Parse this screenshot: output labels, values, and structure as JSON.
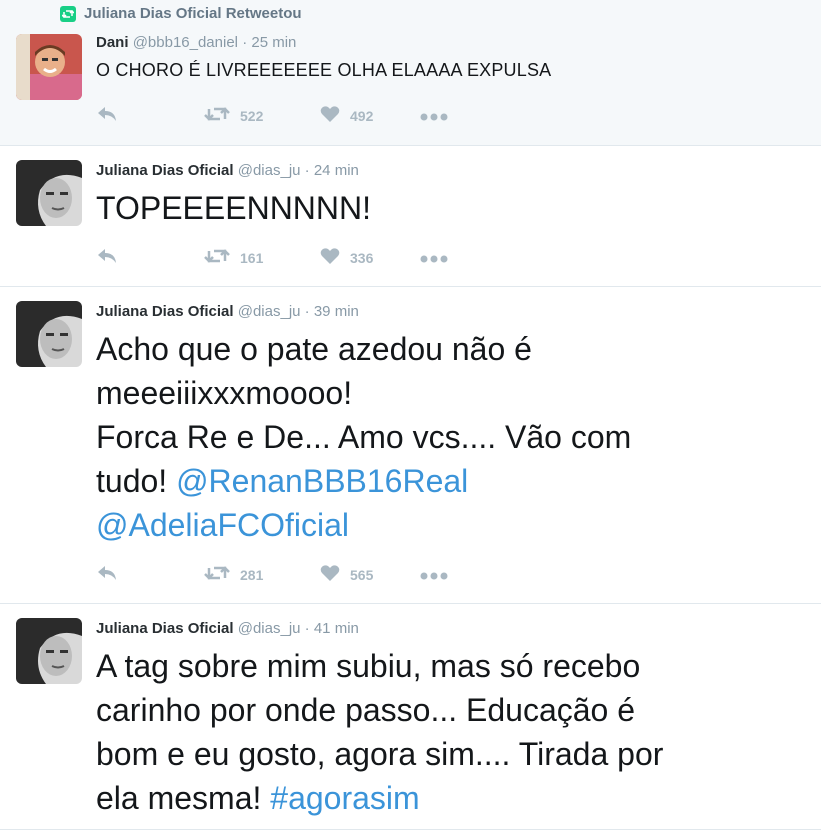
{
  "tweets": [
    {
      "retweet_context": "Juliana Dias Oficial Retweetou",
      "name": "Dani",
      "handle": "@bbb16_daniel",
      "time": "25 min",
      "text": "O CHORO É LIVREEEEEEE OLHA ELAAAA EXPULSA",
      "retweets": "522",
      "likes": "492"
    },
    {
      "name": "Juliana Dias Oficial",
      "handle": "@dias_ju",
      "time": "24 min",
      "text": "TOPEEEENNNNN!",
      "retweets": "161",
      "likes": "336"
    },
    {
      "name": "Juliana Dias Oficial",
      "handle": "@dias_ju",
      "time": "39 min",
      "text_line1": "Acho que o pate azedou não é",
      "text_line2": "meeeiiixxxmoooo!",
      "text_line3": "Forca Re e De... Amo vcs.... Vão com",
      "text_line4_prefix": "tudo! ",
      "mention1": "@RenanBBB16Real",
      "mention2": "@AdeliaFCOficial",
      "retweets": "281",
      "likes": "565"
    },
    {
      "name": "Juliana Dias Oficial",
      "handle": "@dias_ju",
      "time": "41 min",
      "text_line1": "A tag sobre mim subiu, mas só recebo",
      "text_line2": "carinho por onde passo... Educação é",
      "text_line3": "bom e eu gosto, agora sim.... Tirada por",
      "text_line4_prefix": "ela mesma! ",
      "hashtag": "#agorasim"
    }
  ],
  "separator": "·",
  "icons": {
    "reply": "reply-icon",
    "retweet": "retweet-icon",
    "like": "heart-icon",
    "more": "more-icon"
  },
  "colors": {
    "link": "#3b94d9",
    "retweet_badge": "#19cf86",
    "muted": "#8899a6"
  }
}
